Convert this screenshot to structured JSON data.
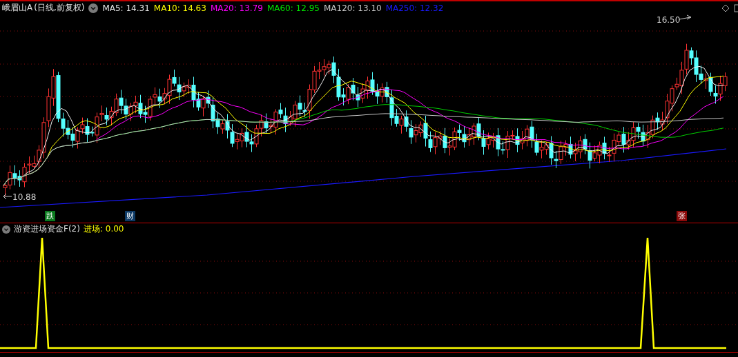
{
  "header": {
    "stock": "峨眉山A",
    "period": "(日线,前复权)",
    "ma_legend": [
      {
        "label": "MA5: 14.31",
        "color": "#e6e6e6"
      },
      {
        "label": "MA10: 14.63",
        "color": "#ffff00"
      },
      {
        "label": "MA20: 13.79",
        "color": "#ff00ff"
      },
      {
        "label": "MA60: 12.95",
        "color": "#00e600"
      },
      {
        "label": "MA120: 13.10",
        "color": "#c8c8c8"
      },
      {
        "label": "MA250: 12.32",
        "color": "#1a1aff"
      }
    ]
  },
  "main_chart": {
    "high_label": "16.50",
    "low_label": "10.88",
    "markers": [
      {
        "text": "跌",
        "color": "#0a7a1e"
      },
      {
        "text": "财",
        "color": "#0d3a66"
      },
      {
        "text": "张",
        "color": "#8b0a0a"
      }
    ]
  },
  "indicator": {
    "name": "游资进场资金F(2)",
    "reading": "进场: 0.00"
  }
}
